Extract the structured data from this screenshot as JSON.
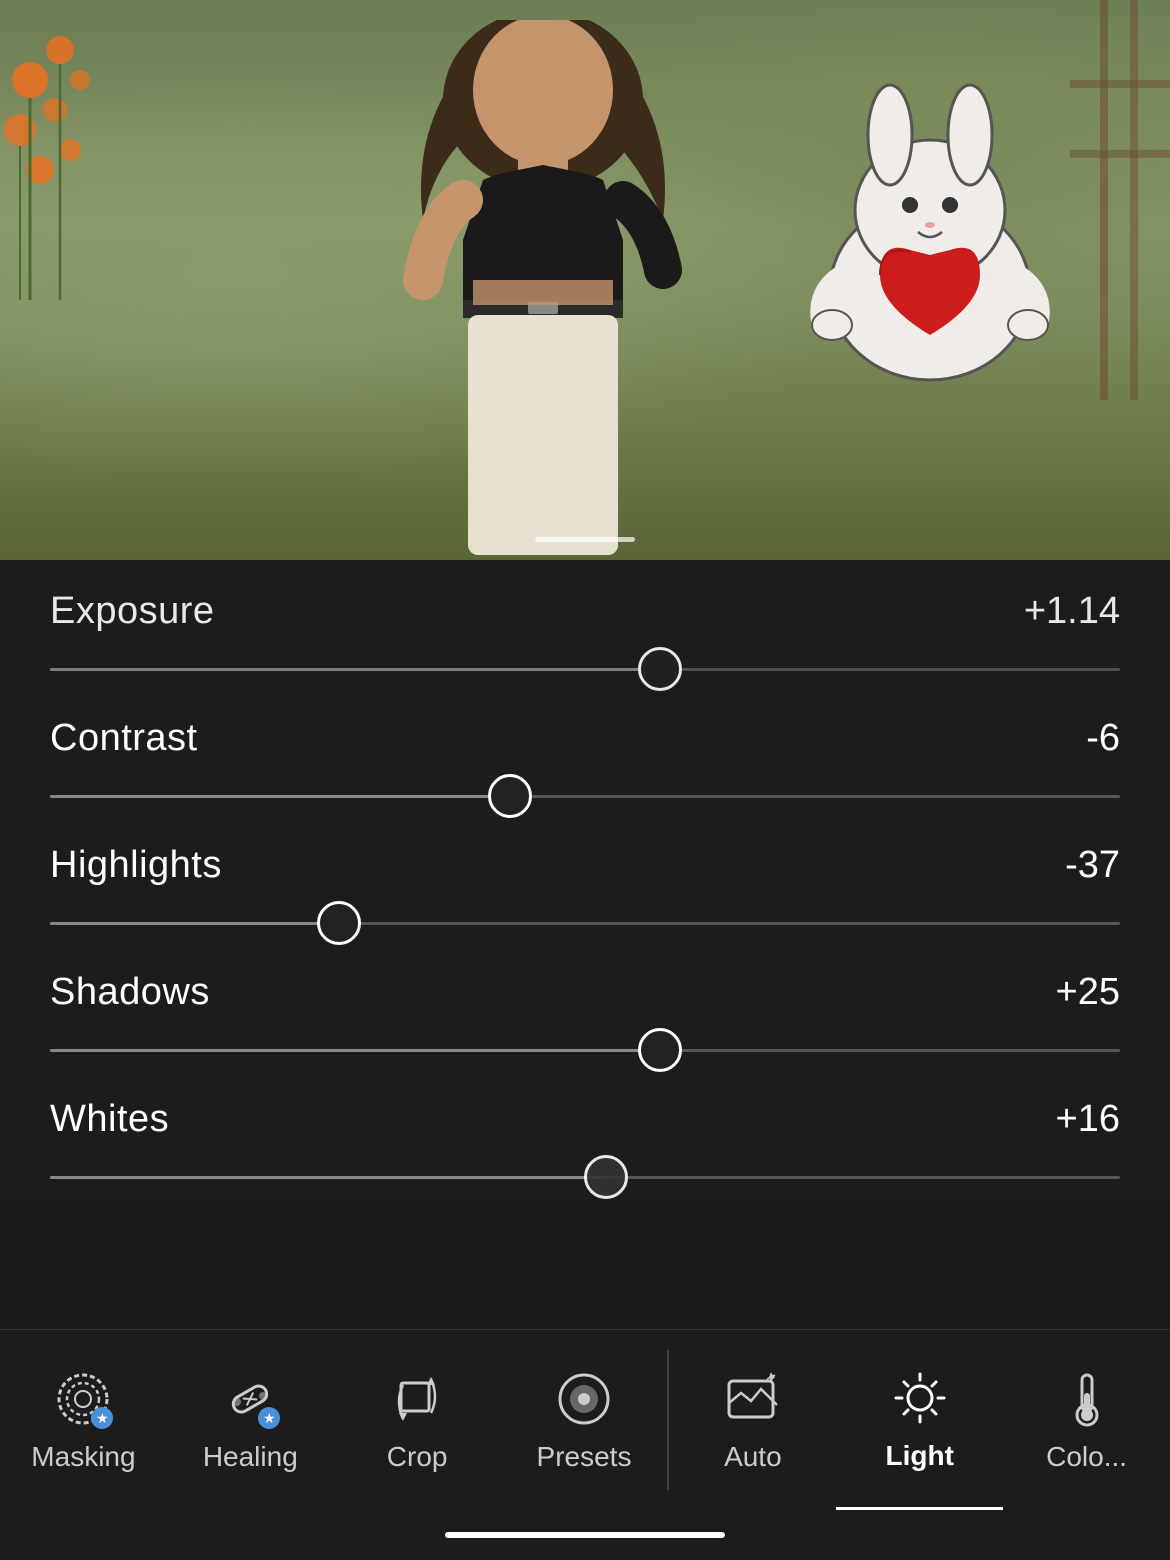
{
  "photo": {
    "alt": "Woman in black crop top and white pants with bunny sticker"
  },
  "sliders": {
    "exposure": {
      "label": "Exposure",
      "value": "+1.14",
      "thumbPercent": 57,
      "fillPercent": 57
    },
    "contrast": {
      "label": "Contrast",
      "value": "-6",
      "thumbPercent": 43,
      "fillPercent": 43
    },
    "highlights": {
      "label": "Highlights",
      "value": "-37",
      "thumbPercent": 27,
      "fillPercent": 27
    },
    "shadows": {
      "label": "Shadows",
      "value": "+25",
      "thumbPercent": 57,
      "fillPercent": 57
    },
    "whites": {
      "label": "Whites",
      "value": "+16",
      "thumbPercent": 52,
      "fillPercent": 52
    }
  },
  "toolbar": {
    "items": [
      {
        "id": "masking",
        "label": "Masking",
        "icon": "masking-icon",
        "active": false,
        "badge": true
      },
      {
        "id": "healing",
        "label": "Healing",
        "icon": "healing-icon",
        "active": false,
        "badge": true
      },
      {
        "id": "crop",
        "label": "Crop",
        "icon": "crop-icon",
        "active": false,
        "badge": false
      },
      {
        "id": "presets",
        "label": "Presets",
        "icon": "presets-icon",
        "active": false,
        "badge": false
      },
      {
        "id": "auto",
        "label": "Auto",
        "icon": "auto-icon",
        "active": false,
        "badge": false
      },
      {
        "id": "light",
        "label": "Light",
        "icon": "light-icon",
        "active": true,
        "badge": false
      },
      {
        "id": "color",
        "label": "Colo...",
        "icon": "color-icon",
        "active": false,
        "badge": false
      }
    ]
  },
  "home_indicator": {
    "visible": true
  }
}
